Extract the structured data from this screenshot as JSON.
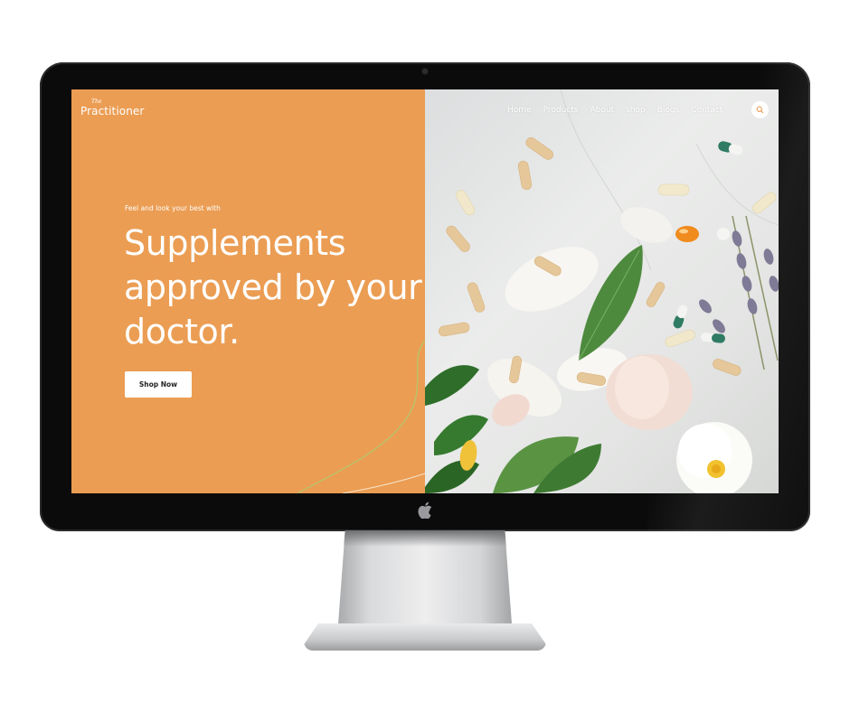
{
  "site": {
    "logo_small": "The",
    "logo_main": "Practitioner"
  },
  "nav": {
    "items": [
      {
        "label": "Home"
      },
      {
        "label": "Products"
      },
      {
        "label": "About"
      },
      {
        "label": "shop"
      },
      {
        "label": "Blogs"
      },
      {
        "label": "Contact"
      }
    ],
    "search_icon": "search-icon"
  },
  "hero": {
    "tagline": "Feel and look your best with",
    "headline": "Supplements approved by your doctor.",
    "cta_label": "Shop Now"
  },
  "colors": {
    "hero_accent": "#eb9d53",
    "curve_line": "#b7c56a",
    "bezel": "#0b0b0c"
  },
  "device": {
    "brand_icon": "apple-logo-icon"
  }
}
